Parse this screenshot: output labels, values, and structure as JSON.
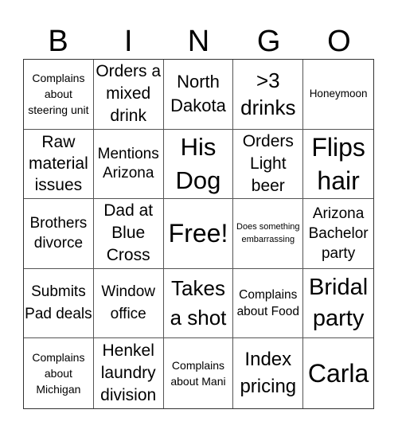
{
  "header": {
    "letters": [
      "B",
      "I",
      "N",
      "G",
      "O"
    ]
  },
  "board": {
    "cells": [
      "Complains about steering unit",
      "Orders a mixed drink",
      "North Dakota",
      ">3 drinks",
      "Honeymoon",
      "Raw material issues",
      "Mentions Arizona",
      "His Dog",
      "Orders Light beer",
      "Flips hair",
      "Brothers divorce",
      "Dad at Blue Cross",
      "Free!",
      "Does something embarrassing",
      "Arizona Bachelor party",
      "Submits Pad deals",
      "Window office",
      "Takes a shot",
      "Complains about Food",
      "Bridal party",
      "Complains about Michigan",
      "Henkel laundry division",
      "Complains about Mani",
      "Index pricing",
      "Carla"
    ]
  }
}
